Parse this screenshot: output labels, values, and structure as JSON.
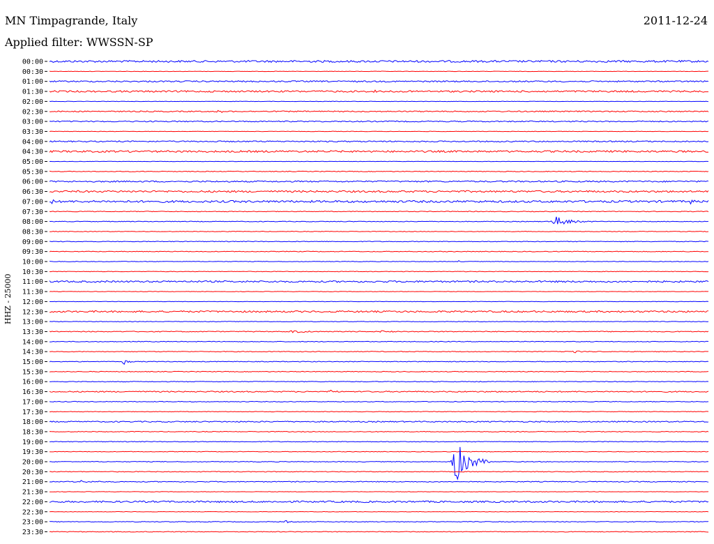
{
  "header": {
    "station": "MN Timpagrande, Italy",
    "filter": "Applied filter: WWSSN-SP",
    "date": "2011-12-24"
  },
  "chart_data": {
    "type": "line",
    "ylabel": "HHZ - 25000",
    "row_labels": [
      "00:00",
      "00:30",
      "01:00",
      "01:30",
      "02:00",
      "02:30",
      "03:00",
      "03:30",
      "04:00",
      "04:30",
      "05:00",
      "05:30",
      "06:00",
      "06:30",
      "07:00",
      "07:30",
      "08:00",
      "08:30",
      "09:00",
      "09:30",
      "10:00",
      "10:30",
      "11:00",
      "11:30",
      "12:00",
      "12:30",
      "13:00",
      "13:30",
      "14:00",
      "14:30",
      "15:00",
      "15:30",
      "16:00",
      "16:30",
      "17:00",
      "17:30",
      "18:00",
      "18:30",
      "19:00",
      "19:30",
      "20:00",
      "20:30",
      "21:00",
      "21:30",
      "22:00",
      "22:30",
      "23:00",
      "23:30"
    ],
    "colors": [
      "#0000ff",
      "#ff0000"
    ],
    "rows": [
      {
        "noise": 1.4,
        "events": []
      },
      {
        "noise": 0.3,
        "events": []
      },
      {
        "noise": 1.0,
        "events": []
      },
      {
        "noise": 1.2,
        "events": [
          {
            "start": 0.48,
            "dur": 0.05,
            "amp": 1.5
          }
        ]
      },
      {
        "noise": 0.3,
        "events": []
      },
      {
        "noise": 0.8,
        "events": [
          {
            "start": 0.25,
            "dur": 0.03,
            "amp": 2
          }
        ]
      },
      {
        "noise": 0.8,
        "events": []
      },
      {
        "noise": 0.3,
        "events": []
      },
      {
        "noise": 0.9,
        "events": []
      },
      {
        "noise": 1.3,
        "events": []
      },
      {
        "noise": 0.3,
        "events": []
      },
      {
        "noise": 0.5,
        "events": []
      },
      {
        "noise": 1.0,
        "events": []
      },
      {
        "noise": 1.3,
        "events": []
      },
      {
        "noise": 1.5,
        "events": [
          {
            "start": 0.0,
            "dur": 0.02,
            "amp": 3
          },
          {
            "start": 0.97,
            "dur": 0.02,
            "amp": 3
          }
        ]
      },
      {
        "noise": 0.5,
        "events": []
      },
      {
        "noise": 0.5,
        "events": [
          {
            "start": 0.759,
            "dur": 0.065,
            "amp": 7
          }
        ]
      },
      {
        "noise": 0.4,
        "events": []
      },
      {
        "noise": 0.5,
        "events": []
      },
      {
        "noise": 0.5,
        "events": []
      },
      {
        "noise": 0.4,
        "events": [
          {
            "start": 0.62,
            "dur": 0.004,
            "amp": 5
          }
        ]
      },
      {
        "noise": 0.4,
        "events": []
      },
      {
        "noise": 1.2,
        "events": []
      },
      {
        "noise": 0.3,
        "events": []
      },
      {
        "noise": 0.3,
        "events": []
      },
      {
        "noise": 1.2,
        "events": []
      },
      {
        "noise": 0.4,
        "events": []
      },
      {
        "noise": 0.6,
        "events": [
          {
            "start": 0.36,
            "dur": 0.06,
            "amp": 2
          },
          {
            "start": 0.45,
            "dur": 0.03,
            "amp": 2
          },
          {
            "start": 0.5,
            "dur": 0.03,
            "amp": 2
          }
        ]
      },
      {
        "noise": 0.5,
        "events": []
      },
      {
        "noise": 0.5,
        "events": [
          {
            "start": 0.79,
            "dur": 0.03,
            "amp": 3
          }
        ]
      },
      {
        "noise": 0.5,
        "events": [
          {
            "start": 0.11,
            "dur": 0.015,
            "amp": 6
          }
        ]
      },
      {
        "noise": 0.5,
        "events": []
      },
      {
        "noise": 0.5,
        "events": [
          {
            "start": 0.65,
            "dur": 0.01,
            "amp": 2
          }
        ]
      },
      {
        "noise": 0.8,
        "events": [
          {
            "start": 0.42,
            "dur": 0.06,
            "amp": 1.8
          }
        ]
      },
      {
        "noise": 0.5,
        "events": []
      },
      {
        "noise": 0.4,
        "events": []
      },
      {
        "noise": 0.8,
        "events": []
      },
      {
        "noise": 0.5,
        "events": []
      },
      {
        "noise": 0.5,
        "events": []
      },
      {
        "noise": 0.4,
        "events": []
      },
      {
        "noise": 0.5,
        "events": [
          {
            "start": 0.608,
            "dur": 0.06,
            "amp": 30
          }
        ]
      },
      {
        "noise": 0.5,
        "events": []
      },
      {
        "noise": 0.6,
        "events": [
          {
            "start": 0.04,
            "dur": 0.06,
            "amp": 1.5
          }
        ]
      },
      {
        "noise": 0.3,
        "events": []
      },
      {
        "noise": 1.2,
        "events": []
      },
      {
        "noise": 0.3,
        "events": []
      },
      {
        "noise": 0.5,
        "events": [
          {
            "start": 0.357,
            "dur": 0.012,
            "amp": 3
          }
        ]
      },
      {
        "noise": 0.5,
        "events": []
      }
    ]
  }
}
